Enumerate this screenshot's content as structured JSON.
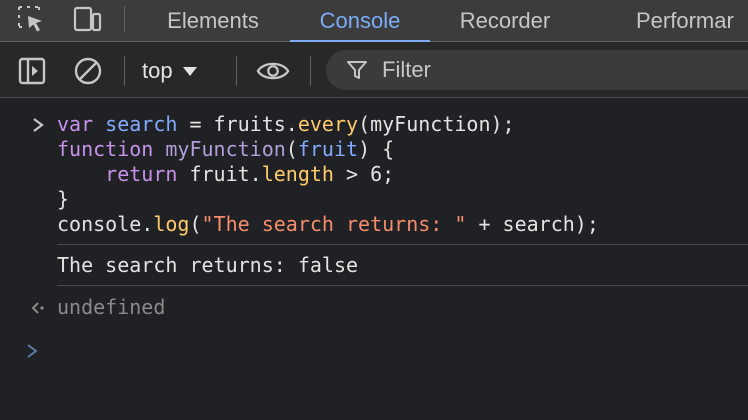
{
  "tabs": [
    {
      "label": "Elements"
    },
    {
      "label": "Console"
    },
    {
      "label": "Recorder"
    },
    {
      "label": "Performar"
    }
  ],
  "toolbar": {
    "context_label": "top",
    "filter_placeholder": "Filter"
  },
  "icons": {
    "inspect": "inspect-element-icon",
    "device": "device-toolbar-icon",
    "sidebar": "sidebar-toggle-icon",
    "clear": "clear-console-icon",
    "eye": "live-expression-icon",
    "filter": "filter-icon"
  },
  "console": {
    "input": {
      "line1": {
        "a": "var",
        "b": " ",
        "c": "search",
        "d": " = fruits.",
        "e": "every",
        "f": "(myFunction);"
      },
      "line2": {
        "a": "function",
        "b": " ",
        "c": "myFunction",
        "d": "(",
        "e": "fruit",
        "f": ") {"
      },
      "line3": {
        "a": "    ",
        "b": "return",
        "c": " fruit.",
        "d": "length",
        "e": " > 6;"
      },
      "line4": {
        "a": "}"
      },
      "line5": {
        "a": "console.",
        "b": "log",
        "c": "(",
        "d": "\"The search returns: \"",
        "e": " + search);"
      }
    },
    "output": "The search returns: false",
    "result": "undefined"
  },
  "colors": {
    "accent": "#7cacf8",
    "keyword": "#c792ea",
    "function_name": "#ffcb6b",
    "string": "#f78c6c",
    "background": "#202124"
  }
}
